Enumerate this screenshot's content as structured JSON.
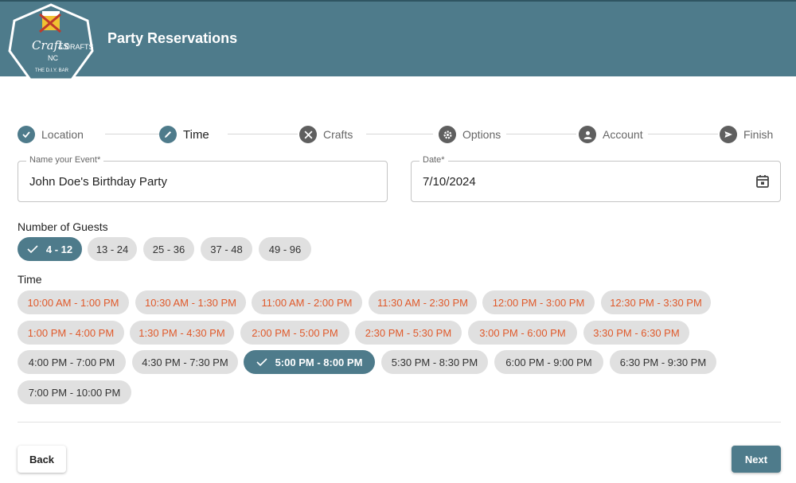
{
  "header": {
    "title": "Party Reservations",
    "logo": {
      "line1": "Crafts",
      "line2": "& DRAFTS",
      "line3": "NC",
      "line4": "THE D.I.Y. BAR",
      "icon": "crafts-and-drafts-logo"
    }
  },
  "stepper": [
    {
      "label": "Location",
      "status": "done",
      "icon": "check-icon"
    },
    {
      "label": "Time",
      "status": "active",
      "icon": "pencil-icon"
    },
    {
      "label": "Crafts",
      "status": "todo",
      "icon": "tools-icon"
    },
    {
      "label": "Options",
      "status": "todo",
      "icon": "gear-icon"
    },
    {
      "label": "Account",
      "status": "todo",
      "icon": "person-icon"
    },
    {
      "label": "Finish",
      "status": "todo",
      "icon": "send-icon"
    }
  ],
  "form": {
    "event_name": {
      "label": "Name your Event*",
      "value": "John Doe's Birthday Party"
    },
    "date": {
      "label": "Date*",
      "value": "7/10/2024",
      "icon": "calendar-icon"
    }
  },
  "guests": {
    "label": "Number of Guests",
    "options": [
      "4 - 12",
      "13 - 24",
      "25 - 36",
      "37 - 48",
      "49 - 96"
    ],
    "selected": "4 - 12"
  },
  "time": {
    "label": "Time",
    "options": [
      "10:00 AM - 1:00 PM",
      "10:30 AM - 1:30 PM",
      "11:00 AM - 2:00 PM",
      "11:30 AM - 2:30 PM",
      "12:00 PM - 3:00 PM",
      "12:30 PM - 3:30 PM",
      "1:00 PM - 4:00 PM",
      "1:30 PM - 4:30 PM",
      "2:00 PM - 5:00 PM",
      "2:30 PM - 5:30 PM",
      "3:00 PM - 6:00 PM",
      "3:30 PM - 6:30 PM",
      "4:00 PM - 7:00 PM",
      "4:30 PM - 7:30 PM",
      "5:00 PM - 8:00 PM",
      "5:30 PM - 8:30 PM",
      "6:00 PM - 9:00 PM",
      "6:30 PM - 9:30 PM",
      "7:00 PM - 10:00 PM"
    ],
    "unavailable_color": "#e0592a",
    "selected": "5:00 PM - 8:00 PM"
  },
  "actions": {
    "back": "Back",
    "next": "Next"
  },
  "colors": {
    "primary": "#4e7b8b",
    "chip": "#e0e0e0",
    "unavailable": "#e0592a"
  }
}
